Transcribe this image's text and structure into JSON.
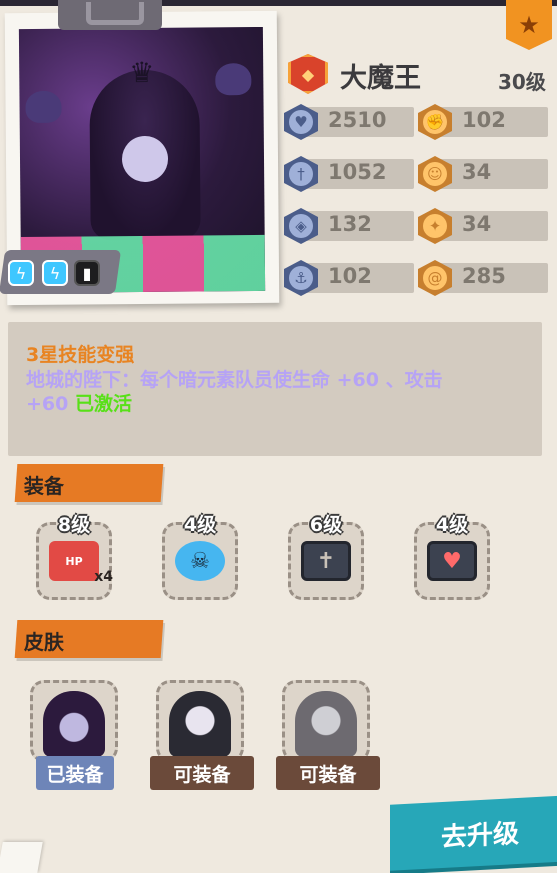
{
  "hero": {
    "name": "大魔王",
    "level": "30级"
  },
  "stats": {
    "left": [
      {
        "icon": "heart-shield-icon",
        "value": "2510"
      },
      {
        "icon": "sword-icon",
        "value": "1052"
      },
      {
        "icon": "shield-icon",
        "value": "132"
      },
      {
        "icon": "anchor-icon",
        "value": "102"
      }
    ],
    "right": [
      {
        "icon": "fist-icon",
        "value": "102"
      },
      {
        "icon": "smile-icon",
        "value": "34"
      },
      {
        "icon": "muscle-icon",
        "value": "34"
      },
      {
        "icon": "swirl-icon",
        "value": "285"
      }
    ]
  },
  "skill": {
    "title": "3星技能变强",
    "desc": "地城的陛下：每个暗元素队员使生命 +60 、攻击 +60",
    "status": "已激活"
  },
  "equipment": {
    "title": "装备",
    "items": [
      {
        "level": "8级",
        "icon": "hp-battery-icon",
        "label": "HP",
        "count": "x4"
      },
      {
        "level": "4级",
        "icon": "blue-skull-icon"
      },
      {
        "level": "6级",
        "icon": "gravestone-tv-icon"
      },
      {
        "level": "4级",
        "icon": "portrait-tv-icon"
      }
    ]
  },
  "skins": {
    "title": "皮肤",
    "items": [
      {
        "button": "已装备",
        "state": "equipped"
      },
      {
        "button": "可装备",
        "state": "available"
      },
      {
        "button": "可装备",
        "state": "available"
      }
    ]
  },
  "actions": {
    "upgrade": "去升级"
  },
  "colors": {
    "accent_orange": "#e67a24",
    "skill_purple": "#b6a3f5",
    "active_green": "#58e018",
    "upgrade_teal": "#27a7b8"
  }
}
